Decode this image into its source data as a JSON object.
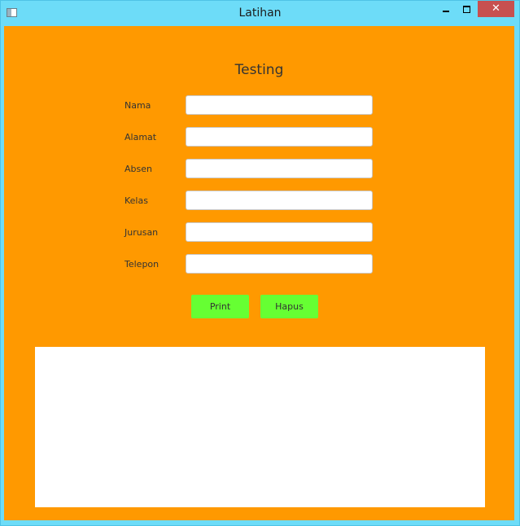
{
  "window": {
    "title": "Latihan",
    "close_glyph": "✕"
  },
  "form": {
    "heading": "Testing",
    "fields": [
      {
        "label": "Nama",
        "value": ""
      },
      {
        "label": "Alamat",
        "value": ""
      },
      {
        "label": "Absen",
        "value": ""
      },
      {
        "label": "Kelas",
        "value": ""
      },
      {
        "label": "Jurusan",
        "value": ""
      },
      {
        "label": "Telepon",
        "value": ""
      }
    ]
  },
  "buttons": {
    "print_label": "Print",
    "hapus_label": "Hapus"
  },
  "output": {
    "value": ""
  },
  "colors": {
    "title_bar": "#6ddcf8",
    "content_background": "#ff9900",
    "button": "#66ff33",
    "close_button": "#c75050"
  },
  "icons": {
    "app": "window-app-icon",
    "minimize": "minimize-icon",
    "maximize": "maximize-icon",
    "close": "close-icon"
  }
}
